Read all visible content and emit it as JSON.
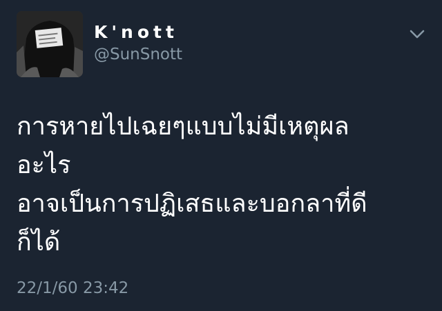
{
  "tweet": {
    "author": {
      "display_name": "K'nott",
      "handle": "@SunSnott",
      "avatar_icon": "user-avatar-photo"
    },
    "menu_icon": "chevron-down-icon",
    "text_lines": [
      "การหายไปเฉยๆแบบไม่มีเหตุผล",
      "อะไร",
      "อาจเป็นการปฏิเสธและบอกลาที่ดี",
      "ก็ได้"
    ],
    "timestamp": "22/1/60 23:42"
  },
  "colors": {
    "background": "#1b2431",
    "primary_text": "#ffffff",
    "secondary_text": "#8899a6"
  }
}
